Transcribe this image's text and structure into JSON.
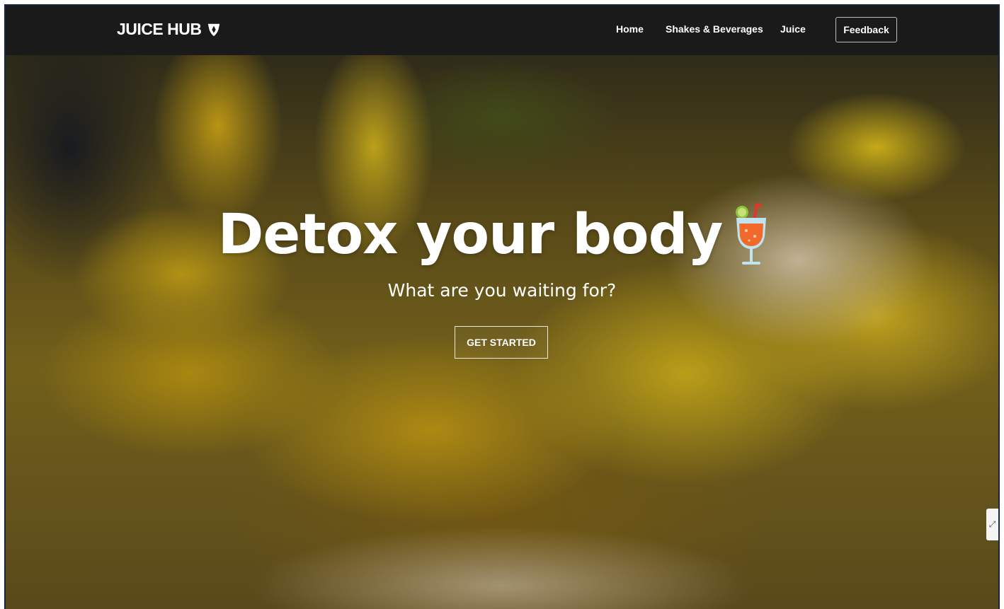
{
  "brand": {
    "name": "JUICE HUB",
    "icon": "shield-leaf-icon"
  },
  "nav": {
    "items": [
      {
        "label": "Home"
      },
      {
        "label": "Shakes & Beverages"
      },
      {
        "label": "Juice"
      }
    ],
    "feedback_label": "Feedback"
  },
  "hero": {
    "title": "Detox your body",
    "title_icon": "cocktail-icon",
    "subtitle": "What are you waiting for?",
    "cta_label": "GET STARTED"
  },
  "side_widget": {
    "icon": "expand-icon"
  },
  "colors": {
    "navbar": "#1b1a1b",
    "text": "#ffffff",
    "accent_yellow": "#e3c01f"
  }
}
